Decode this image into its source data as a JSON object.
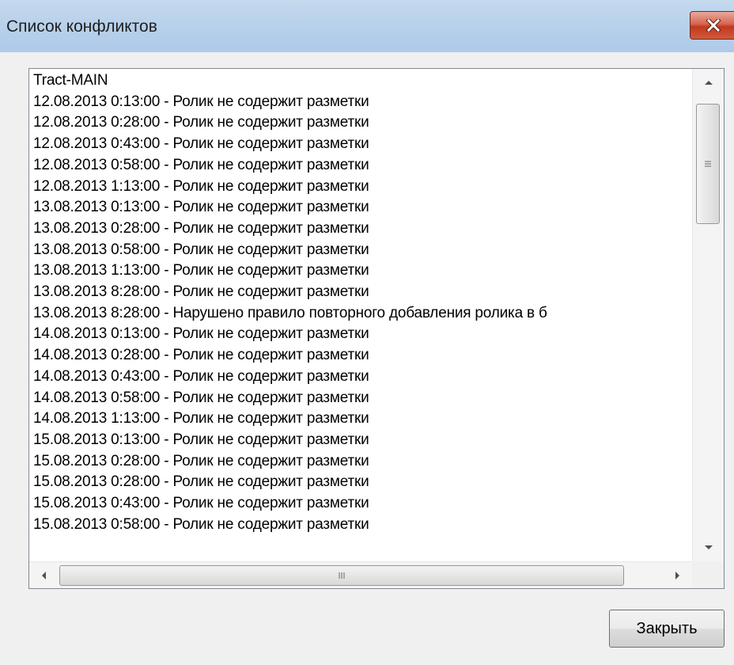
{
  "window": {
    "title": "Список конфликтов"
  },
  "list": {
    "items": [
      "Tract-MAIN",
      "12.08.2013 0:13:00 - Ролик не содержит разметки",
      "12.08.2013 0:28:00 - Ролик не содержит разметки",
      "12.08.2013 0:43:00 - Ролик не содержит разметки",
      "12.08.2013 0:58:00 - Ролик не содержит разметки",
      "12.08.2013 1:13:00 - Ролик не содержит разметки",
      "13.08.2013 0:13:00 - Ролик не содержит разметки",
      "13.08.2013 0:28:00 - Ролик не содержит разметки",
      "13.08.2013 0:58:00 - Ролик не содержит разметки",
      "13.08.2013 1:13:00 - Ролик не содержит разметки",
      "13.08.2013 8:28:00 - Ролик не содержит разметки",
      "13.08.2013 8:28:00 - Нарушено правило повторного добавления ролика в б",
      "14.08.2013 0:13:00 - Ролик не содержит разметки",
      "14.08.2013 0:28:00 - Ролик не содержит разметки",
      "14.08.2013 0:43:00 - Ролик не содержит разметки",
      "14.08.2013 0:58:00 - Ролик не содержит разметки",
      "14.08.2013 1:13:00 - Ролик не содержит разметки",
      "15.08.2013 0:13:00 - Ролик не содержит разметки",
      "15.08.2013 0:28:00 - Ролик не содержит разметки",
      "15.08.2013 0:28:00 - Ролик не содержит разметки",
      "15.08.2013 0:43:00 - Ролик не содержит разметки",
      "15.08.2013 0:58:00 - Ролик не содержит разметки"
    ]
  },
  "buttons": {
    "close_label": "Закрыть"
  },
  "icons": {
    "close": "close-icon",
    "scroll_up": "chevron-up-icon",
    "scroll_down": "chevron-down-icon",
    "scroll_left": "chevron-left-icon",
    "scroll_right": "chevron-right-icon",
    "grip": "grip-icon"
  },
  "colors": {
    "title_bar": "#b9d1ea",
    "close_button": "#c9452e",
    "window_bg": "#f0f0f0"
  }
}
